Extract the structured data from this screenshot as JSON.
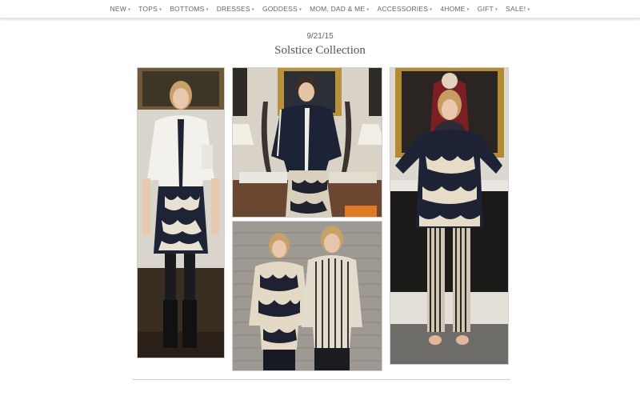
{
  "nav": {
    "items": [
      {
        "label": "NEW",
        "has_dropdown": true
      },
      {
        "label": "TOPS",
        "has_dropdown": true
      },
      {
        "label": "BOTTOMS",
        "has_dropdown": true
      },
      {
        "label": "DRESSES",
        "has_dropdown": true
      },
      {
        "label": "GODDESS",
        "has_dropdown": true
      },
      {
        "label": "MOM, DAD & ME",
        "has_dropdown": true
      },
      {
        "label": "ACCESSORIES",
        "has_dropdown": true
      },
      {
        "label": "4HOME",
        "has_dropdown": true
      },
      {
        "label": "GIFT",
        "has_dropdown": true
      },
      {
        "label": "SALE!",
        "has_dropdown": true
      }
    ],
    "dropdown_icon": "chevron-down-icon"
  },
  "page": {
    "date": "9/21/15",
    "title": "Solstice Collection"
  },
  "colors": {
    "nav_text": "#666666",
    "title_text": "#555555",
    "background": "#ffffff"
  }
}
